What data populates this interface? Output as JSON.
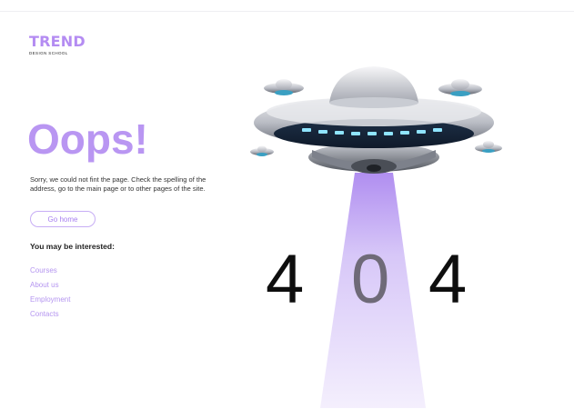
{
  "brand": {
    "name": "TREND",
    "tagline": "DESIGN SCHOOL"
  },
  "heading": "Oops!",
  "message": "Sorry, we could not fint the page. Check the spelling of the address, go to the main page or to other pages of the site.",
  "go_home_label": "Go home",
  "interest_heading": "You may be interested:",
  "links": [
    "Courses",
    "About us",
    "Employment",
    "Contacts"
  ],
  "error_code": [
    "4",
    "0",
    "4"
  ],
  "colors": {
    "accent": "#b48cf2",
    "beam": "#c9b2f7",
    "text": "#1d1d1d"
  }
}
